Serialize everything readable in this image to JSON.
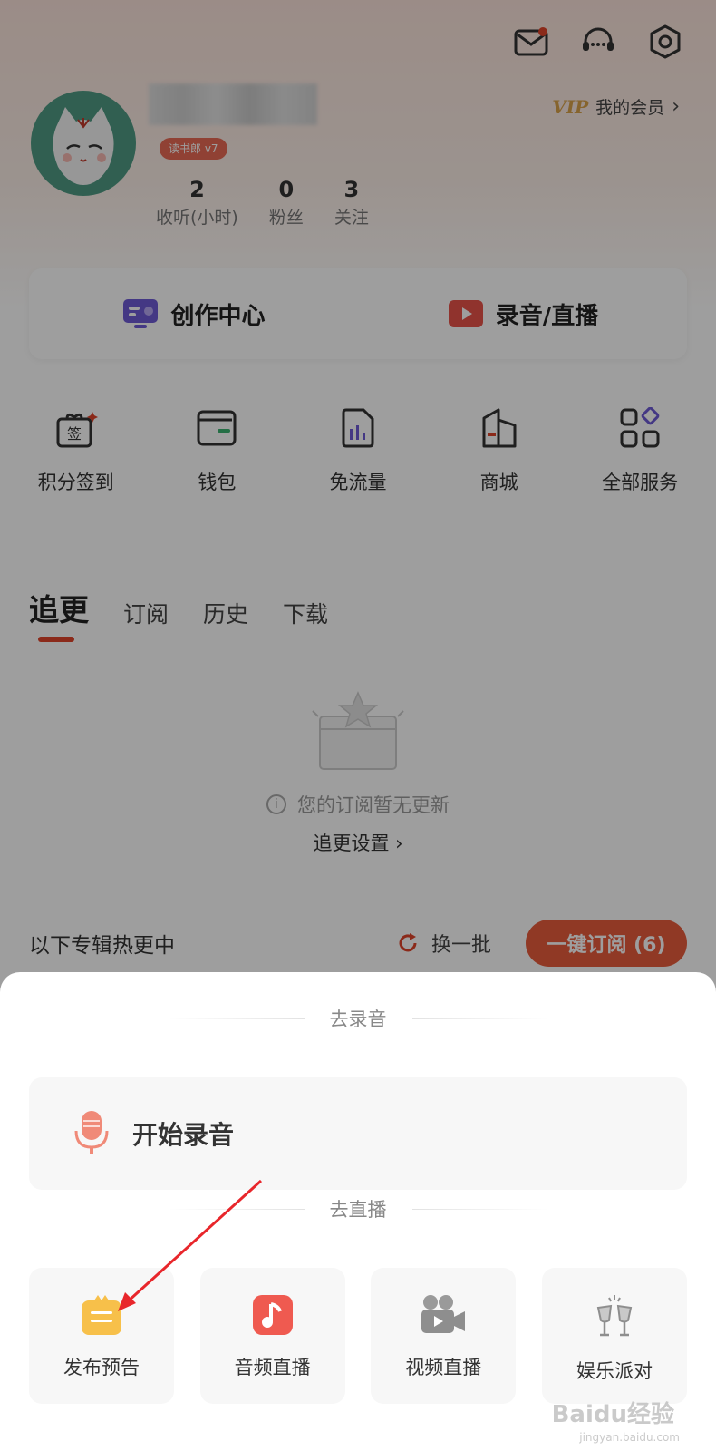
{
  "header": {
    "icons": [
      "mail-icon",
      "headset-icon",
      "settings-icon"
    ],
    "vip_logo": "VIP",
    "vip_label": "我的会员",
    "vip_chevron": "›"
  },
  "profile": {
    "level_badge": "读书郎 v7",
    "stats": [
      {
        "value": "2",
        "label": "收听(小时)"
      },
      {
        "value": "0",
        "label": "粉丝"
      },
      {
        "value": "3",
        "label": "关注"
      }
    ]
  },
  "create": {
    "creation_center": "创作中心",
    "record_live": "录音/直播"
  },
  "services": [
    {
      "icon": "gift-signin-icon",
      "label": "积分签到",
      "glyph": "签"
    },
    {
      "icon": "wallet-icon",
      "label": "钱包"
    },
    {
      "icon": "data-sim-icon",
      "label": "免流量"
    },
    {
      "icon": "store-icon",
      "label": "商城"
    },
    {
      "icon": "grid-icon",
      "label": "全部服务"
    }
  ],
  "tabs": [
    "追更",
    "订阅",
    "历史",
    "下载"
  ],
  "empty_state": {
    "message": "您的订阅暂无更新",
    "info_glyph": "i",
    "setting_link": "追更设置 ›"
  },
  "hot": {
    "title": "以下专辑热更中",
    "refresh_label": "换一批",
    "subscribe_button": "一键订阅 (6)"
  },
  "sheet": {
    "record_section": "去录音",
    "start_record": "开始录音",
    "live_section": "去直播",
    "live_items": [
      {
        "icon": "announcement-icon",
        "label": "发布预告"
      },
      {
        "icon": "music-note-icon",
        "label": "音频直播"
      },
      {
        "icon": "video-camera-icon",
        "label": "视频直播"
      },
      {
        "icon": "cheers-icon",
        "label": "娱乐派对"
      }
    ]
  },
  "colors": {
    "accent": "#e0452b",
    "subscribe_button": "#e95c3d",
    "vip_gold": "#d9a24a"
  },
  "watermark": {
    "brand": "Baidu经验",
    "url": "jingyan.baidu.com"
  }
}
